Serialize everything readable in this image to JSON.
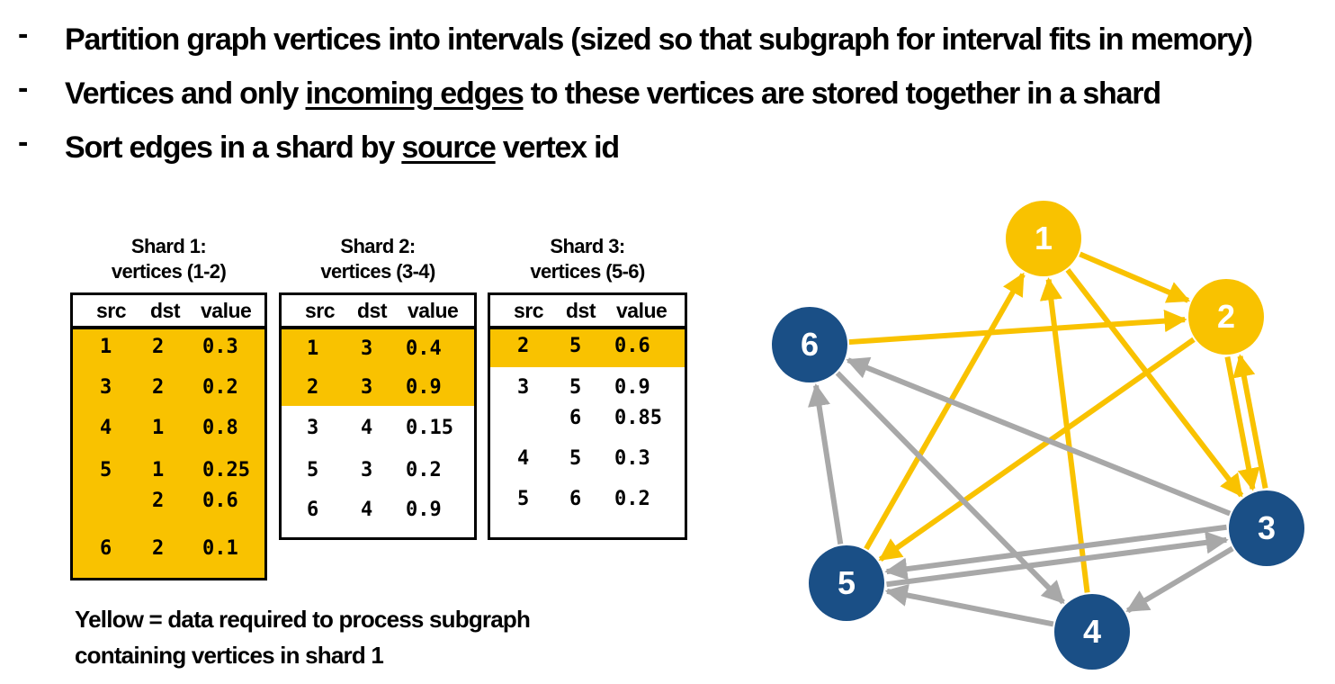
{
  "bullets": [
    {
      "dash": "-",
      "parts": [
        {
          "text": "Partition graph vertices into intervals (sized so that subgraph for interval fits in memory)",
          "u": false
        }
      ]
    },
    {
      "dash": "-",
      "parts": [
        {
          "text": "Vertices and only ",
          "u": false
        },
        {
          "text": "incoming edges",
          "u": true
        },
        {
          "text": " to these vertices are stored together in a shard",
          "u": false
        }
      ]
    },
    {
      "dash": "-",
      "parts": [
        {
          "text": "Sort edges in a shard by ",
          "u": false
        },
        {
          "text": "source",
          "u": true
        },
        {
          "text": " vertex id",
          "u": false
        }
      ]
    }
  ],
  "columns": [
    "src",
    "dst",
    "value"
  ],
  "shards": [
    {
      "title": "Shard 1:",
      "subtitle": "vertices (1-2)",
      "rows": [
        {
          "src": "1",
          "dst": "2",
          "value": "0.3",
          "highlight": true
        },
        {
          "src": "3",
          "dst": "2",
          "value": "0.2",
          "highlight": true
        },
        {
          "src": "4",
          "dst": "1",
          "value": "0.8",
          "highlight": true
        },
        {
          "src": "5",
          "dst": "1",
          "value": "0.25",
          "highlight": true
        },
        {
          "src": "",
          "dst": "2",
          "value": "0.6",
          "highlight": true
        },
        {
          "src": "6",
          "dst": "2",
          "value": "0.1",
          "highlight": true
        }
      ]
    },
    {
      "title": "Shard 2:",
      "subtitle": "vertices (3-4)",
      "rows": [
        {
          "src": "1",
          "dst": "3",
          "value": "0.4",
          "highlight": true
        },
        {
          "src": "2",
          "dst": "3",
          "value": "0.9",
          "highlight": true
        },
        {
          "src": "3",
          "dst": "4",
          "value": "0.15",
          "highlight": false
        },
        {
          "src": "5",
          "dst": "3",
          "value": "0.2",
          "highlight": false
        },
        {
          "src": "6",
          "dst": "4",
          "value": "0.9",
          "highlight": false
        }
      ]
    },
    {
      "title": "Shard 3:",
      "subtitle": "vertices (5-6)",
      "rows": [
        {
          "src": "2",
          "dst": "5",
          "value": "0.6",
          "highlight": true
        },
        {
          "src": "3",
          "dst": "5",
          "value": "0.9",
          "highlight": false
        },
        {
          "src": "",
          "dst": "6",
          "value": "0.85",
          "highlight": false
        },
        {
          "src": "4",
          "dst": "5",
          "value": "0.3",
          "highlight": false
        },
        {
          "src": "5",
          "dst": "6",
          "value": "0.2",
          "highlight": false
        }
      ]
    }
  ],
  "caption": [
    "Yellow = data required to process subgraph",
    "containing vertices in shard 1"
  ],
  "graph": {
    "colors": {
      "yellow": "#f9c200",
      "blue": "#1a4f86",
      "gray": "#a8a8a8"
    },
    "nodes": [
      {
        "id": "1",
        "label": "1",
        "group": "yellow"
      },
      {
        "id": "2",
        "label": "2",
        "group": "yellow"
      },
      {
        "id": "3",
        "label": "3",
        "group": "blue"
      },
      {
        "id": "4",
        "label": "4",
        "group": "blue"
      },
      {
        "id": "5",
        "label": "5",
        "group": "blue"
      },
      {
        "id": "6",
        "label": "6",
        "group": "blue"
      }
    ],
    "edges": [
      {
        "from": "1",
        "to": "2",
        "color": "yellow"
      },
      {
        "from": "1",
        "to": "3",
        "color": "yellow"
      },
      {
        "from": "2",
        "to": "3",
        "color": "yellow"
      },
      {
        "from": "3",
        "to": "2",
        "color": "yellow"
      },
      {
        "from": "2",
        "to": "5",
        "color": "yellow"
      },
      {
        "from": "4",
        "to": "1",
        "color": "yellow"
      },
      {
        "from": "5",
        "to": "1",
        "color": "yellow"
      },
      {
        "from": "6",
        "to": "2",
        "color": "yellow"
      },
      {
        "from": "3",
        "to": "6",
        "color": "gray"
      },
      {
        "from": "3",
        "to": "4",
        "color": "gray"
      },
      {
        "from": "3",
        "to": "5",
        "color": "gray"
      },
      {
        "from": "5",
        "to": "3",
        "color": "gray"
      },
      {
        "from": "4",
        "to": "5",
        "color": "gray"
      },
      {
        "from": "5",
        "to": "6",
        "color": "gray"
      },
      {
        "from": "6",
        "to": "4",
        "color": "gray"
      }
    ]
  }
}
